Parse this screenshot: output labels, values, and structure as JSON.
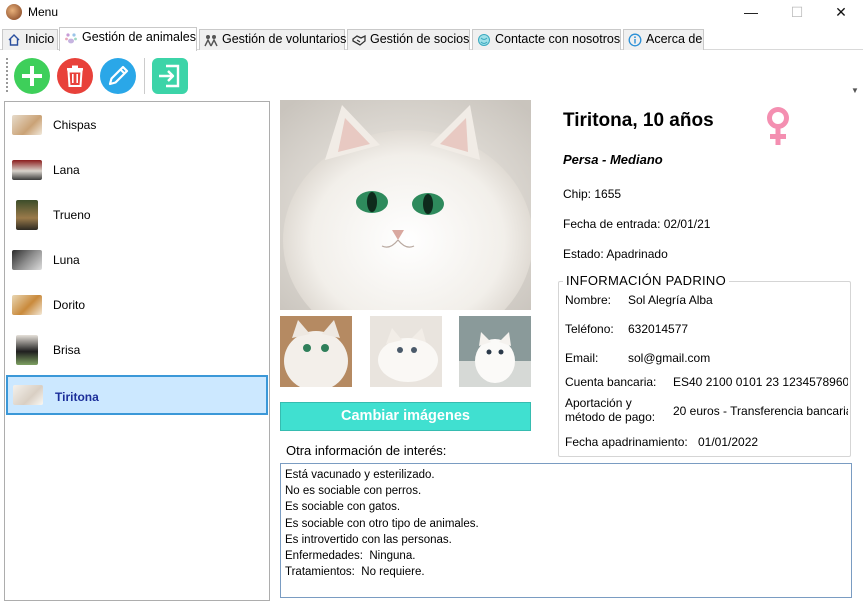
{
  "window": {
    "title": "Menu",
    "minimize": "—",
    "maximize": "☐",
    "close": "✕"
  },
  "tabs": [
    {
      "label": "Inicio",
      "icon": "home-icon"
    },
    {
      "label": "Gestión de animales",
      "icon": "paw-icon"
    },
    {
      "label": "Gestión de voluntarios",
      "icon": "people-icon"
    },
    {
      "label": "Gestión de socios",
      "icon": "handshake-icon"
    },
    {
      "label": "Contacte con nosotros",
      "icon": "globe-icon"
    },
    {
      "label": "Acerca de",
      "icon": "info-icon"
    }
  ],
  "toolbar": {
    "add": "add",
    "delete": "delete",
    "edit": "edit",
    "exit": "exit",
    "colors": {
      "add": "#3ecf5a",
      "delete": "#e8413a",
      "edit": "#2aa7e8",
      "exit": "#3cd4a8"
    }
  },
  "animals": [
    "Chispas",
    "Lana",
    "Trueno",
    "Luna",
    "Dorito",
    "Brisa",
    "Tiritona"
  ],
  "selected_animal": "Tiritona",
  "detail": {
    "name_age": "Tiritona, 10 años",
    "breed": "Persa - Mediano",
    "chip": "Chip: 1655",
    "entry_date": "Fecha de entrada: 02/01/21",
    "status": "Estado: Apadrinado",
    "sex_icon": "female-icon"
  },
  "change_images_label": "Cambiar imágenes",
  "padrino": {
    "title": "INFORMACIÓN PADRINO",
    "name_label": "Nombre:",
    "name": "Sol Alegría Alba",
    "phone_label": "Teléfono:",
    "phone": "632014577",
    "email_label": "Email:",
    "email": "sol@gmail.com",
    "bank_label": "Cuenta bancaria:",
    "bank": "ES40 2100 0101 23 1234578960",
    "payment_label_1": "Aportación y",
    "payment_label_2": "método de pago:",
    "payment": "20 euros - Transferencia bancaria",
    "date_label": "Fecha apadrinamiento:",
    "date": "01/01/2022"
  },
  "other_info": {
    "label": "Otra información de interés:",
    "lines": [
      "Está vacunado y esterilizado.",
      "No es sociable con perros.",
      "Es sociable con gatos.",
      "Es sociable con otro tipo de animales.",
      "Es introvertido con las personas.",
      "Enfermedades:  Ninguna.",
      "Tratamientos:  No requiere."
    ]
  },
  "colors": {
    "accent_button": "#40e0d0",
    "selection": "#cce8ff",
    "selection_border": "#3b98d8",
    "female": "#f48fb1"
  }
}
